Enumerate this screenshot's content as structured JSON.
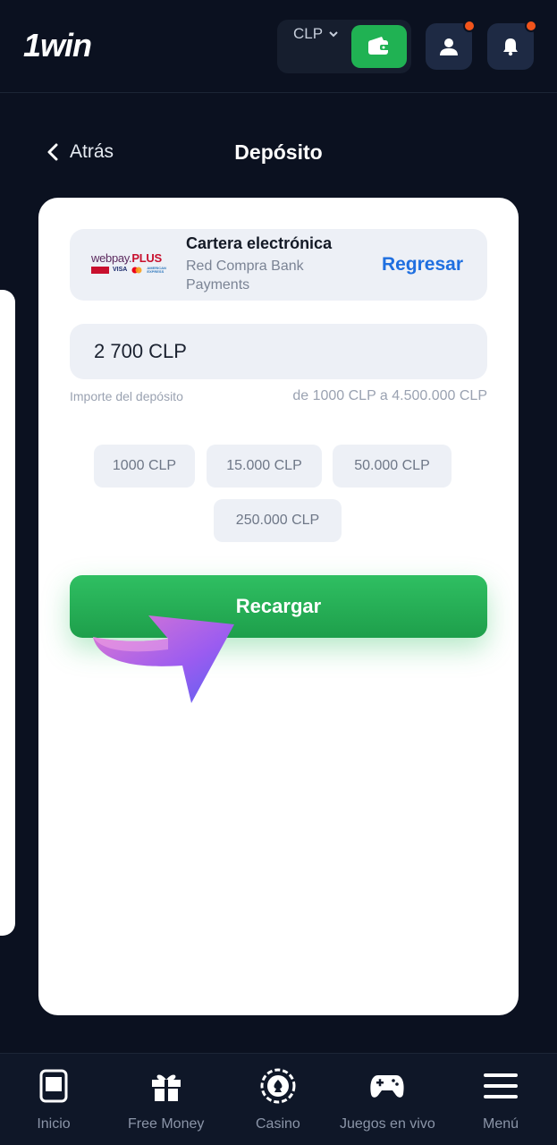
{
  "header": {
    "logo": "1win",
    "currency": "CLP",
    "colors": {
      "bg": "#0b1120",
      "green": "#20b253",
      "notify": "#f2541b"
    }
  },
  "subheader": {
    "back_label": "Atrás",
    "title": "Depósito"
  },
  "payment_method": {
    "logo_icon": "webpay-plus-logo",
    "logo_text_main": "webpay.",
    "logo_text_plus": "PLUS",
    "logo_cards": [
      "redcompra",
      "VISA",
      "mastercard",
      "AMERICAN EXPRESS"
    ],
    "name": "Cartera electrónica",
    "subtitle": "Red Compra Bank Payments",
    "action_label": "Regresar"
  },
  "amount": {
    "value": "2 700 CLP",
    "label": "Importe del depósito",
    "range": "de 1000 CLP a 4.500.000 CLP"
  },
  "quick_amounts": [
    "1000 CLP",
    "15.000 CLP",
    "50.000 CLP",
    "250.000 CLP"
  ],
  "submit_label": "Recargar",
  "bottom_nav": [
    {
      "label": "Inicio",
      "icon": "home-tablet-icon"
    },
    {
      "label": "Free Money",
      "icon": "gift-icon"
    },
    {
      "label": "Casino",
      "icon": "casino-chip-icon"
    },
    {
      "label": "Juegos en vivo",
      "icon": "gamepad-icon"
    },
    {
      "label": "Menú",
      "icon": "hamburger-menu-icon"
    }
  ]
}
